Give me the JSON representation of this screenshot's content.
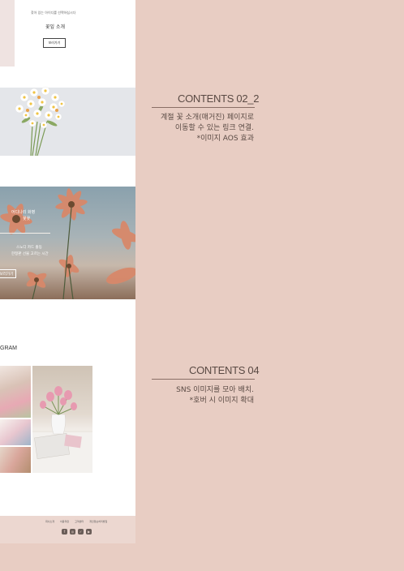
{
  "site": {
    "intro": {
      "tagline": "찾아 있는 아이디를 선택하십시다",
      "title": "꽃잎 소개",
      "button": "보러가기"
    },
    "hero": {
      "line1": "어디나리 화병",
      "line2": "꽃꽂",
      "line3": "스노디 카드 출동",
      "line4": "한정판 선물 고르는 시간",
      "button": "보러가기"
    },
    "instagram": {
      "title": "GRAM"
    },
    "footer": {
      "links": [
        "회사소개",
        "이용약관",
        "고객센터",
        "개인정보처리방침"
      ],
      "socials": [
        "facebook-icon",
        "instagram-icon",
        "twitter-icon",
        "youtube-icon"
      ]
    }
  },
  "notes": [
    {
      "title": "CONTENTS 02_2",
      "lines": [
        "계절 꽃 소개(매거진) 페이지로",
        "이동할 수 있는 링크 연결.",
        "*이미지 AOS 효과"
      ]
    },
    {
      "title": "CONTENTS 04",
      "lines": [
        "SNS 이미지를 모아 배치.",
        "*호버 시 이미지 확대"
      ]
    }
  ],
  "colors": {
    "background": "#e8cdc3",
    "footer": "#ecd7d0",
    "text": "#5a4a44"
  }
}
